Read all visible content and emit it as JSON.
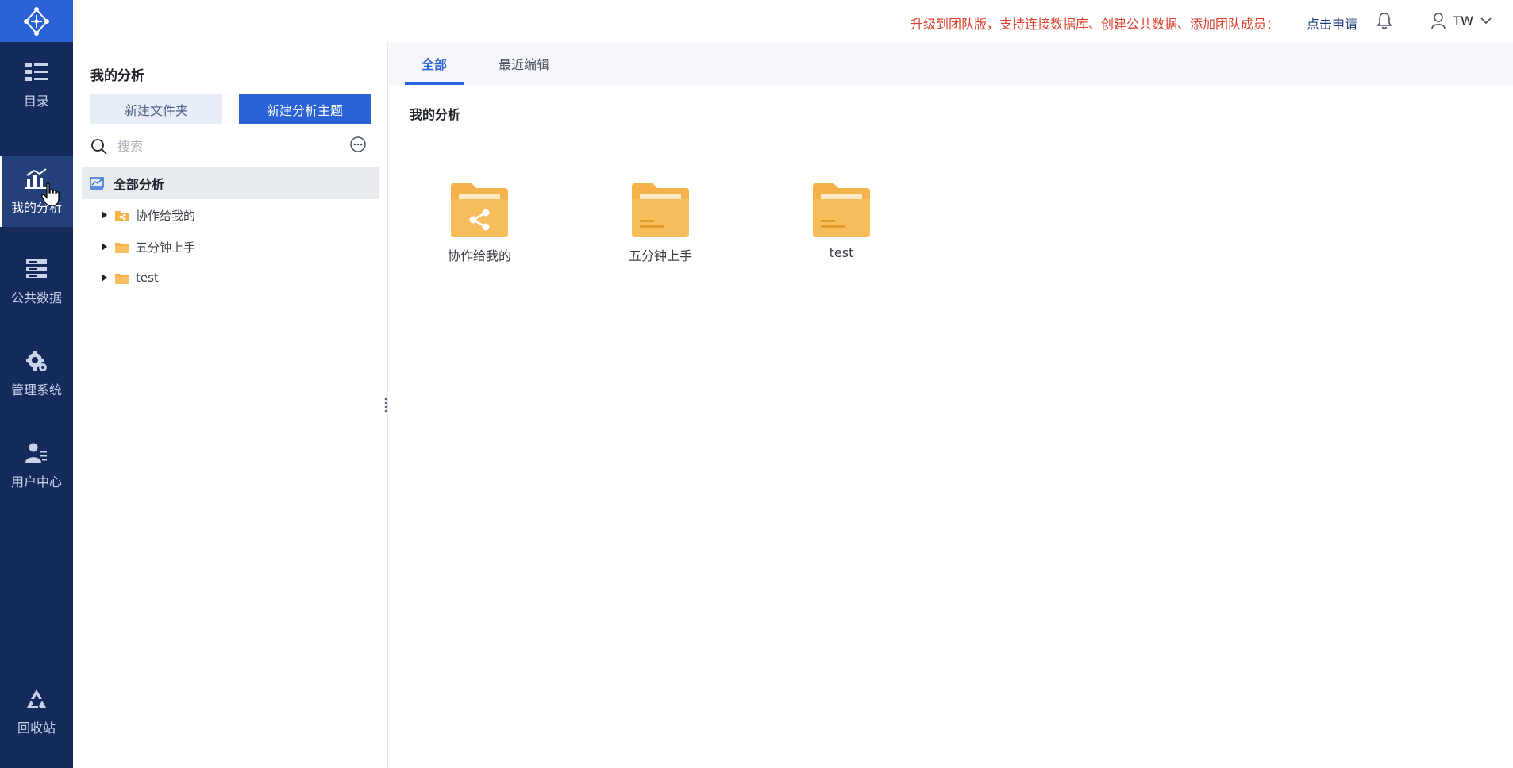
{
  "topbar": {
    "promo_text": "升级到团队版，支持连接数据库、创建公共数据、添加团队成员：",
    "apply_link": "点击申请",
    "user_name": "TW"
  },
  "leftnav": {
    "items": [
      {
        "label": "目录",
        "icon": "catalog-icon"
      },
      {
        "label": "我的分析",
        "icon": "analysis-chart-icon"
      },
      {
        "label": "公共数据",
        "icon": "database-icon"
      },
      {
        "label": "管理系统",
        "icon": "gear-icon"
      },
      {
        "label": "用户中心",
        "icon": "user-icon"
      }
    ],
    "recycle_label": "回收站",
    "active": "我的分析"
  },
  "panel": {
    "title": "我的分析",
    "new_folder_label": "新建文件夹",
    "new_topic_label": "新建分析主题",
    "search_placeholder": "搜索",
    "tree_root": "全部分析",
    "tree_items": [
      {
        "label": "协作给我的",
        "icon": "shared-folder-icon"
      },
      {
        "label": "五分钟上手",
        "icon": "folder-icon"
      },
      {
        "label": "test",
        "icon": "folder-icon"
      }
    ]
  },
  "main": {
    "tabs": [
      "全部",
      "最近编辑"
    ],
    "active_tab": "全部",
    "section_title": "我的分析",
    "folders": [
      {
        "label": "协作给我的",
        "icon": "shared-folder-icon"
      },
      {
        "label": "五分钟上手",
        "icon": "folder-icon"
      },
      {
        "label": "test",
        "icon": "folder-icon"
      }
    ]
  },
  "colors": {
    "nav_bg": "#142a5a",
    "accent": "#2a63d7",
    "promo": "#d8402b",
    "folder": "#f5b24a"
  }
}
